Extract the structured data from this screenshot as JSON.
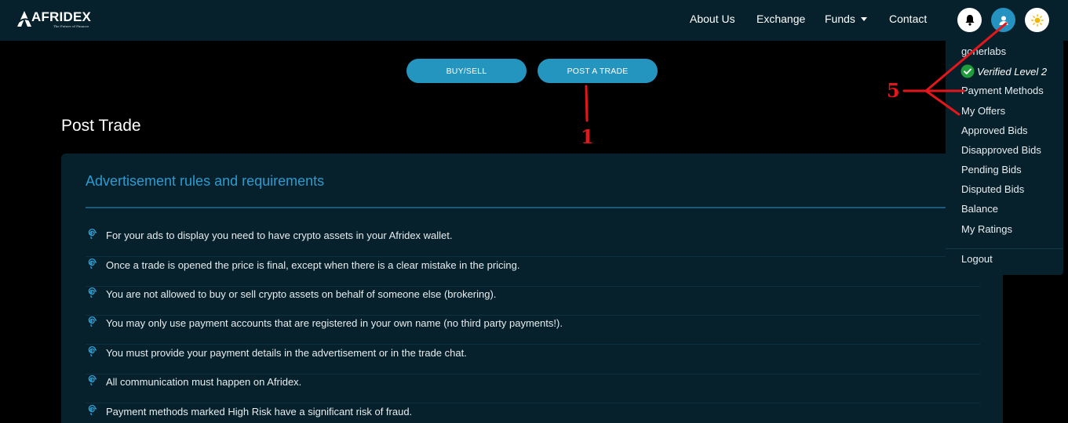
{
  "nav": {
    "logo": "AFRIDEX",
    "logo_tagline": "The Future of Finance",
    "links": [
      {
        "label": "About Us"
      },
      {
        "label": "Exchange"
      },
      {
        "label": "Funds"
      },
      {
        "label": "Contact"
      }
    ],
    "icons": [
      "bell-icon",
      "user-icon",
      "sun-icon"
    ]
  },
  "tabs": {
    "buy_sell": "BUY/SELL",
    "post_trade": "POST A TRADE"
  },
  "page": {
    "title": "Post Trade"
  },
  "rules": {
    "heading": "Advertisement rules and requirements",
    "items": [
      "For your ads to display you need to have crypto assets in your Afridex wallet.",
      "Once a trade is opened the price is final, except when there is a clear mistake in the pricing.",
      "You are not allowed to buy or sell crypto assets on behalf of someone else (brokering).",
      "You may only use payment accounts that are registered in your own name (no third party payments!).",
      "You must provide your payment details in the advertisement or in the trade chat.",
      "All communication must happen on Afridex.",
      "Payment methods marked High Risk have a significant risk of fraud."
    ]
  },
  "user_menu": {
    "username": "gonerlabs",
    "verified": "Verified Level 2",
    "items": [
      "Payment Methods",
      "My Offers",
      "Approved Bids",
      "Disapproved Bids",
      "Pending Bids",
      "Disputed Bids",
      "Balance",
      "My Ratings"
    ],
    "logout": "Logout"
  },
  "annotations": {
    "label_1": "1",
    "label_5": "5"
  },
  "colors": {
    "nav_bg": "#06212b",
    "accent": "#2495bf",
    "annotation": "#e3171b",
    "verified": "#1f9d3a"
  }
}
